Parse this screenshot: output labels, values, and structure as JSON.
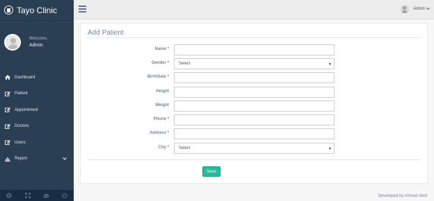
{
  "brand": {
    "title": "Tayo Clinic",
    "logo_icon": "hospital-icon"
  },
  "profile": {
    "welcome": "Welcome,",
    "name": "Admin"
  },
  "sidebar": {
    "items": [
      {
        "label": "Dashboard",
        "icon": "home-icon"
      },
      {
        "label": "Patient",
        "icon": "edit-icon"
      },
      {
        "label": "Appointment",
        "icon": "edit-icon"
      },
      {
        "label": "Doctors",
        "icon": "edit-icon"
      },
      {
        "label": "Users",
        "icon": "edit-icon"
      },
      {
        "label": "Report",
        "icon": "bar-chart-icon",
        "has_submenu": true
      }
    ],
    "footer_buttons": [
      "settings-icon",
      "fullscreen-icon",
      "eye-slash-icon",
      "power-icon"
    ]
  },
  "topnav": {
    "user_label": "Admin"
  },
  "form": {
    "title": "Add Patient",
    "fields": [
      {
        "label": "Name",
        "required": true,
        "value": ""
      },
      {
        "label": "Gender",
        "required": true,
        "value": "Select"
      },
      {
        "label": "BirthDate",
        "required": true,
        "value": ""
      },
      {
        "label": "Height",
        "required": false,
        "value": ""
      },
      {
        "label": "Weight",
        "required": false,
        "value": ""
      },
      {
        "label": "Phone",
        "required": true,
        "value": ""
      },
      {
        "label": "Address",
        "required": true,
        "value": ""
      },
      {
        "label": "City",
        "required": true,
        "value": "Select"
      }
    ],
    "required_marker": "*",
    "save_label": "Save"
  },
  "footer": {
    "credit": "Developed by Ahmed Abdi"
  },
  "colors": {
    "sidebar": "#2a3f54",
    "accent": "#26b99a",
    "text": "#73879c"
  }
}
